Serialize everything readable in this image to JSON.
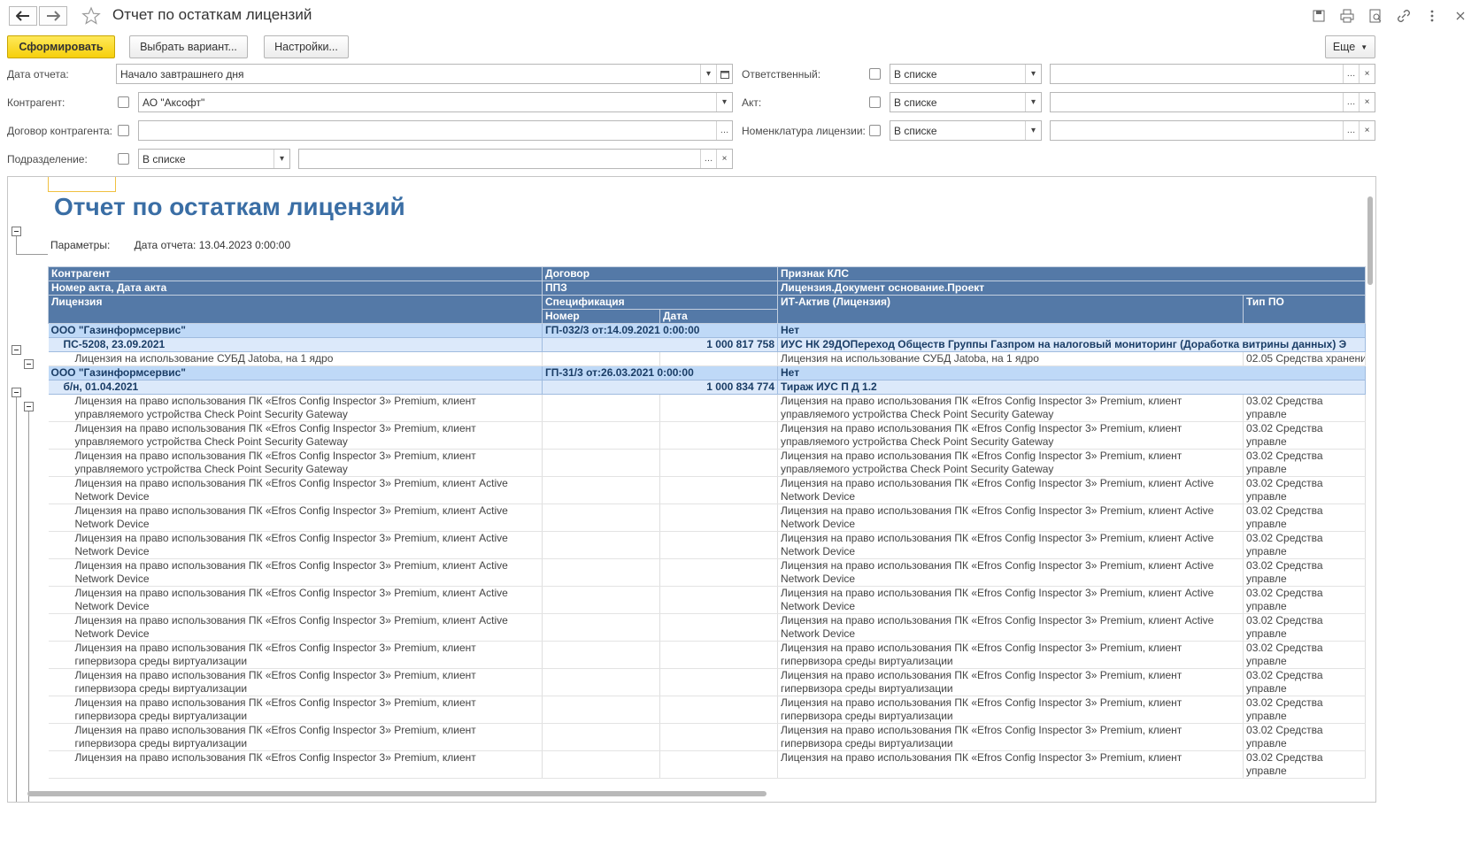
{
  "window": {
    "title": "Отчет по остаткам лицензий"
  },
  "toolbar": {
    "generate": "Сформировать",
    "choose_variant": "Выбрать вариант...",
    "settings": "Настройки...",
    "more": "Еще"
  },
  "filters": {
    "report_date_label": "Дата отчета:",
    "report_date_value": "Начало завтрашнего дня",
    "counterparty_label": "Контрагент:",
    "counterparty_value": "АО \"Аксофт\"",
    "contract_label": "Договор контрагента:",
    "contract_value": "",
    "department_label": "Подразделение:",
    "department_mode": "В списке",
    "department_value": "",
    "responsible_label": "Ответственный:",
    "responsible_mode": "В списке",
    "responsible_value": "",
    "act_label": "Акт:",
    "act_mode": "В списке",
    "act_value": "",
    "nomenclature_label": "Номенклатура лицензии:",
    "nomenclature_mode": "В списке",
    "nomenclature_value": ""
  },
  "report": {
    "title": "Отчет по остаткам лицензий",
    "params_label": "Параметры:",
    "params_value": "Дата отчета: 13.04.2023 0:00:00",
    "headers": {
      "counterparty": "Контрагент",
      "contract": "Договор",
      "kls": "Признак КЛС",
      "act": "Номер акта, Дата акта",
      "ppz": "ППЗ",
      "project": "Лицензия.Документ основание.Проект",
      "license": "Лицензия",
      "spec": "Спецификация",
      "it_asset": "ИТ-Актив (Лицензия)",
      "software_type": "Тип ПО",
      "number": "Номер",
      "date": "Дата"
    },
    "groups": [
      {
        "counterparty": "ООО \"Газинформсервис\"",
        "contract": "ГП-032/3 от:14.09.2021 0:00:00",
        "kls": "Нет",
        "act": "ПС-5208, 23.09.2021",
        "ppz": "1 000 817 758",
        "project": "ИУС НК 29ДОПереход Обществ Группы Газпром на налоговый мониторинг (Доработка витрины данных) Э",
        "rows": [
          {
            "license": "Лицензия на использование СУБД Jatoba, на 1 ядро",
            "it_asset": "Лицензия на использование СУБД Jatoba, на 1 ядро",
            "software_type": "02.05 Средства хранени"
          }
        ]
      },
      {
        "counterparty": "ООО \"Газинформсервис\"",
        "contract": "ГП-31/3 от:26.03.2021 0:00:00",
        "kls": "Нет",
        "act": "б/н, 01.04.2021",
        "ppz": "1 000 834 774",
        "project": "Тираж ИУС П Д 1.2",
        "rows": [
          {
            "license": "Лицензия на право использования ПК «Efros Config Inspector 3» Premium, клиент управляемого устройства Check Point Security Gateway",
            "it_asset": "Лицензия на право использования ПК «Efros Config Inspector 3» Premium, клиент управляемого устройства Check Point Security Gateway",
            "software_type": "03.02 Средства управле"
          },
          {
            "license": "Лицензия на право использования ПК «Efros Config Inspector 3» Premium, клиент управляемого устройства Check Point Security Gateway",
            "it_asset": "Лицензия на право использования ПК «Efros Config Inspector 3» Premium, клиент управляемого устройства Check Point Security Gateway",
            "software_type": "03.02 Средства управле"
          },
          {
            "license": "Лицензия на право использования ПК «Efros Config Inspector 3» Premium, клиент управляемого устройства Check Point Security Gateway",
            "it_asset": "Лицензия на право использования ПК «Efros Config Inspector 3» Premium, клиент управляемого устройства Check Point Security Gateway",
            "software_type": "03.02 Средства управле"
          },
          {
            "license": "Лицензия на право использования ПК «Efros Config Inspector 3» Premium, клиент Active Network Device",
            "it_asset": "Лицензия на право использования ПК «Efros Config Inspector 3» Premium, клиент Active Network Device",
            "software_type": "03.02 Средства управле"
          },
          {
            "license": "Лицензия на право использования ПК «Efros Config Inspector 3» Premium, клиент Active Network Device",
            "it_asset": "Лицензия на право использования ПК «Efros Config Inspector 3» Premium, клиент Active Network Device",
            "software_type": "03.02 Средства управле"
          },
          {
            "license": "Лицензия на право использования ПК «Efros Config Inspector 3» Premium, клиент Active Network Device",
            "it_asset": "Лицензия на право использования ПК «Efros Config Inspector 3» Premium, клиент Active Network Device",
            "software_type": "03.02 Средства управле"
          },
          {
            "license": "Лицензия на право использования ПК «Efros Config Inspector 3» Premium, клиент Active Network Device",
            "it_asset": "Лицензия на право использования ПК «Efros Config Inspector 3» Premium, клиент Active Network Device",
            "software_type": "03.02 Средства управле"
          },
          {
            "license": "Лицензия на право использования ПК «Efros Config Inspector 3» Premium, клиент Active Network Device",
            "it_asset": "Лицензия на право использования ПК «Efros Config Inspector 3» Premium, клиент Active Network Device",
            "software_type": "03.02 Средства управле"
          },
          {
            "license": "Лицензия на право использования ПК «Efros Config Inspector 3» Premium, клиент Active Network Device",
            "it_asset": "Лицензия на право использования ПК «Efros Config Inspector 3» Premium, клиент Active Network Device",
            "software_type": "03.02 Средства управле"
          },
          {
            "license": "Лицензия на право использования ПК «Efros Config Inspector 3» Premium, клиент гипервизора среды виртуализации",
            "it_asset": "Лицензия на право использования ПК «Efros Config Inspector 3» Premium, клиент гипервизора среды виртуализации",
            "software_type": "03.02 Средства управле"
          },
          {
            "license": "Лицензия на право использования ПК «Efros Config Inspector 3» Premium, клиент гипервизора среды виртуализации",
            "it_asset": "Лицензия на право использования ПК «Efros Config Inspector 3» Premium, клиент гипервизора среды виртуализации",
            "software_type": "03.02 Средства управле"
          },
          {
            "license": "Лицензия на право использования ПК «Efros Config Inspector 3» Premium, клиент гипервизора среды виртуализации",
            "it_asset": "Лицензия на право использования ПК «Efros Config Inspector 3» Premium, клиент гипервизора среды виртуализации",
            "software_type": "03.02 Средства управле"
          },
          {
            "license": "Лицензия на право использования ПК «Efros Config Inspector 3» Premium, клиент гипервизора среды виртуализации",
            "it_asset": "Лицензия на право использования ПК «Efros Config Inspector 3» Premium, клиент гипервизора среды виртуализации",
            "software_type": "03.02 Средства управле"
          },
          {
            "license": "Лицензия на право использования ПК «Efros Config Inspector 3» Premium, клиент",
            "it_asset": "Лицензия на право использования ПК «Efros Config Inspector 3» Premium, клиент",
            "software_type": "03.02 Средства управле"
          }
        ]
      }
    ]
  }
}
